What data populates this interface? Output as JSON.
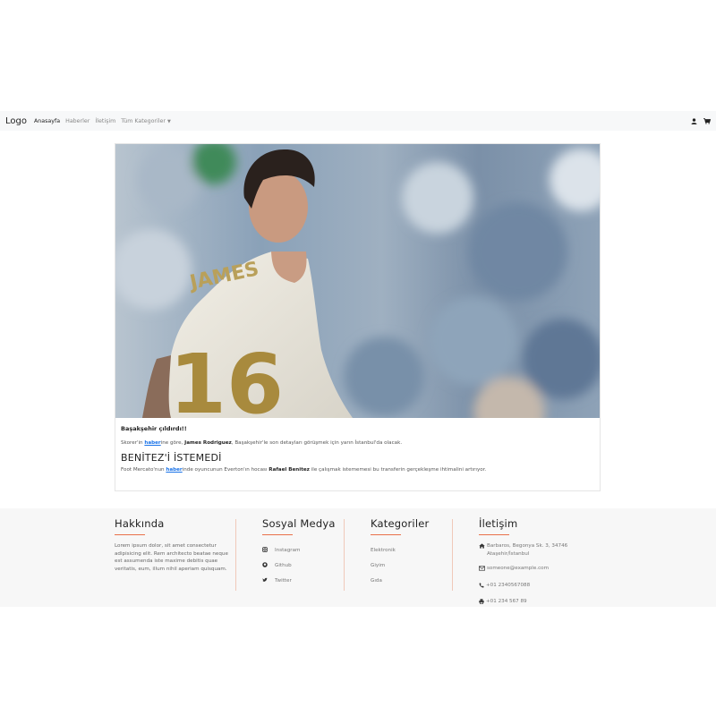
{
  "navbar": {
    "logo": "Logo",
    "links": [
      "Anasayfa",
      "Haberler",
      "İletişim",
      "Tüm Kategoriler"
    ],
    "icons": [
      "user-icon",
      "cart-icon"
    ]
  },
  "article": {
    "kicker": "Başakşehir çıldırdı!!",
    "p1_pre": "Skorer'in ",
    "p1_link": "haber",
    "p1_mid": "ine göre, ",
    "p1_bold": "James Rodriguez",
    "p1_post": ", Başakşehir'le son detayları görüşmek için yarın İstanbul'da olacak.",
    "heading": "BENİTEZ'İ İSTEMEDİ",
    "p2_pre": "Foot Mercato'nun ",
    "p2_link": "haber",
    "p2_mid": "inde oyuncunun Everton'ın hocası ",
    "p2_bold": "Rafael Benitez",
    "p2_post": " ile çalışmak istememesi bu transferin gerçekleşme ihtimalini artırıyor."
  },
  "footer": {
    "about": {
      "title": "Hakkında",
      "text": "Lorem ipsum dolor, sit amet consectetur adipisicing elit. Rem architecto beatae neque est assumenda iste maxime debitis quae veritatis, eum, illum nihil aperiam quisquam."
    },
    "social": {
      "title": "Sosyal Medya",
      "items": [
        {
          "label": "Instagram",
          "icon": "instagram-icon"
        },
        {
          "label": "Github",
          "icon": "github-icon"
        },
        {
          "label": "Twitter",
          "icon": "twitter-icon"
        }
      ]
    },
    "categories": {
      "title": "Kategoriler",
      "items": [
        "Elektronik",
        "Giyim",
        "Gıda"
      ]
    },
    "contact": {
      "title": "İletişim",
      "address": "Barbaros, Begonya Sk. 3, 34746 Ataşehir/İstanbul",
      "email": "someone@example.com",
      "phone": "+01 2340567088",
      "fax": "+01 234 567 89"
    }
  },
  "colors": {
    "accent": "#e8704a",
    "link": "#1a73e8",
    "navbar_bg": "#f7f8f9",
    "footer_bg": "#f7f7f7"
  }
}
